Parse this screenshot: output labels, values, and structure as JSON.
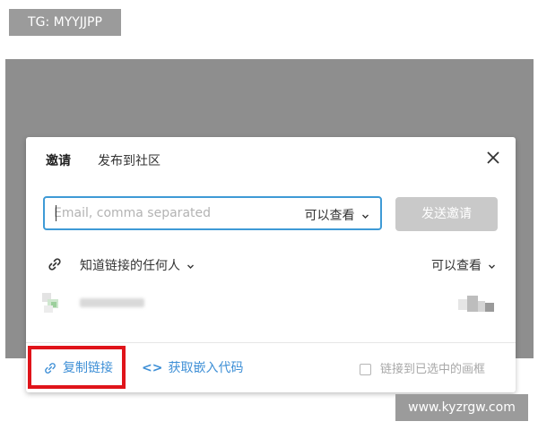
{
  "watermarks": {
    "top": "TG: MYYJJPP",
    "bottom": "www.kyzrgw.com"
  },
  "dialog": {
    "tabs": [
      {
        "label": "邀请",
        "active": true
      },
      {
        "label": "发布到社区",
        "active": false
      }
    ],
    "close_icon": "close-icon",
    "invite": {
      "placeholder": "Email, comma separated",
      "value": "",
      "permission": "可以查看",
      "send_label": "发送邀请"
    },
    "link_access": {
      "icon": "link-icon",
      "audience": "知道链接的任何人",
      "permission": "可以查看"
    },
    "footer": {
      "copy_link": "复制链接",
      "embed_code": "获取嵌入代码",
      "embed_glyph": "<>",
      "link_to_selected": "链接到已选中的画框",
      "link_to_selected_checked": false
    }
  },
  "colors": {
    "accent": "#3e9ad6",
    "link": "#3e8fd6",
    "highlight": "#e0141a",
    "disabled_button": "#c9c9c9"
  }
}
